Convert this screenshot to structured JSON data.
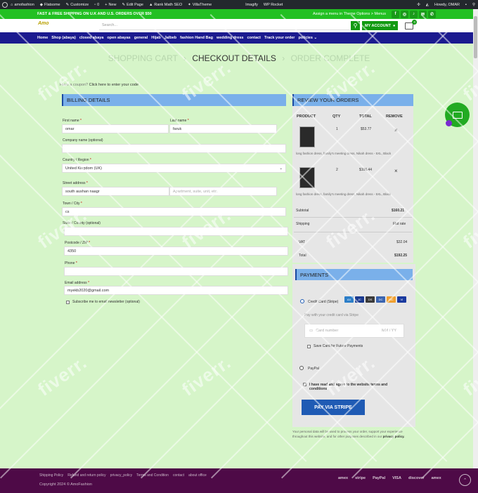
{
  "adminbar": {
    "site": "amofashion",
    "flatsome": "Flatsome",
    "customize": "Customize",
    "comments": "0",
    "new": "New",
    "edit_page": "Edit Page",
    "rank_math": "Rank Math SEO",
    "villatheme": "VillaTheme",
    "imagify": "Imagify",
    "wp_rocket": "WP Rocket",
    "howdy": "Howdy, OMAR"
  },
  "topbar": {
    "promo": "FAST & FREE SHIPPING ON U.K AND U.S. ORDERS OVER $50",
    "menu_hint": "Assign a menu in Theme Options > Menus"
  },
  "header": {
    "logo": "Amo",
    "search_placeholder": "Search...",
    "my_account": "MY ACCOUNT",
    "cart_count": "0"
  },
  "nav": [
    "Home",
    "Shop (abaya)",
    "closed abaya",
    "open abayas",
    "general",
    "Hijab",
    "Jalbeb",
    "fashion Hand Bag",
    "wedding dress",
    "contact",
    "Track your order",
    "policies"
  ],
  "steps": {
    "cart": "SHOPPING CART",
    "checkout": "CHECKOUT DETAILS",
    "complete": "ORDER COMPLETE"
  },
  "coupon": {
    "text": "Have a coupon?",
    "link": "Click here to enter your code"
  },
  "billing": {
    "title": "BILLING DETAILS",
    "first_name_label": "First name",
    "first_name": "omar",
    "last_name_label": "Last name",
    "last_name": "faruk",
    "company_label": "Company name (optional)",
    "country_label": "Country / Region",
    "country": "United Kingdom (UK)",
    "street_label": "Street address",
    "street": "south aushan naagr",
    "apartment_placeholder": "Apartment, suite, unit, etc.",
    "town_label": "Town / City",
    "town": "cs",
    "county_label": "State / County (optional)",
    "postcode_label": "Postcode / ZIP",
    "postcode": "4350",
    "phone_label": "Phone",
    "email_label": "Email address",
    "email": "myekb2020@gmail.com",
    "subscribe": "Subscribe me to email newsletter (optional)",
    "req": "*"
  },
  "review": {
    "title": "REVIEW YOUR ORDERS",
    "col_product": "PRODUCT",
    "col_qty": "QTY",
    "col_total": "TOTAL",
    "col_remove": "REMOVE",
    "items": [
      {
        "qty": "1",
        "total": "$53.77",
        "name": "long fashion dress, family's meeting dress, Nikah dress - 5XL, Black"
      },
      {
        "qty": "2",
        "total": "$106.44",
        "name": "long fashion dress, family's meeting dress, Nikah dress - 5XL, Black"
      }
    ],
    "remove_glyph": "×",
    "subtotal_label": "Subtotal",
    "subtotal": "$160.21",
    "shipping_label": "Shipping",
    "shipping": "Flat rate",
    "vat_label": "VAT",
    "vat": "$32.04",
    "total_label": "Total",
    "total": "$192.25"
  },
  "payments": {
    "title": "PAYMENTS",
    "stripe_label": "Credit Card (Stripe)",
    "stripe_desc": "Pay with your credit card via Stripe",
    "card_placeholder": "Card number",
    "expiry_placeholder": "MM / YY",
    "save_card": "Save Card for Future Payments",
    "paypal": "PayPal",
    "terms": "I have read and agree to the website terms and conditions",
    "button": "PAY VIA STRIPE",
    "privacy": "Your personal data will be used to process your order, support your experience throughout this website, and for other purposes described in our",
    "privacy_link": "privacy policy."
  },
  "footer": {
    "links": [
      "Shipping Policy",
      "Refund and return policy",
      "privacy_policy",
      "Terms and Condition",
      "contact",
      "about office"
    ],
    "copyright": "Copyright 2024 © AmoFashion",
    "payment_icons": [
      "amex",
      "stripe",
      "PayPal",
      "VISA",
      "discover",
      "amex"
    ]
  },
  "watermark": "fiverr.",
  "colors": {
    "page_bg": "#d6f5c9",
    "brand_green": "#22c022",
    "nav_blue": "#1b1a8f",
    "section_blue": "#7ab0ea",
    "pay_button": "#1f5bb4",
    "footer": "#4e0a47"
  }
}
